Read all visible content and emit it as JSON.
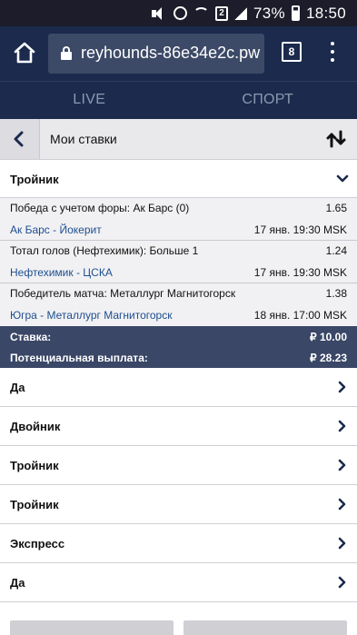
{
  "status_bar": {
    "battery": "73%",
    "time": "18:50",
    "sim_label": "2"
  },
  "browser": {
    "url": "reyhounds-86e34e2c.pw",
    "tab_count": "8"
  },
  "nav_tabs": [
    {
      "label": "LIVE"
    },
    {
      "label": "СПОРТ"
    }
  ],
  "page": {
    "title": "Мои ставки"
  },
  "expanded_bet": {
    "label": "Тройник",
    "selections": [
      {
        "market": "Победа с учетом форы: Ак Барс (0)",
        "odds": "1.65",
        "event": "Ак Барс - Йокерит",
        "time": "17 янв. 19:30 MSK"
      },
      {
        "market": "Тотал голов (Нефтехимик): Больше 1",
        "odds": "1.24",
        "event": "Нефтехимик - ЦСКА",
        "time": "17 янв. 19:30 MSK"
      },
      {
        "market": "Победитель матча: Металлург Магнитогорск",
        "odds": "1.38",
        "event": "Югра - Металлург Магнитогорск",
        "time": "18 янв. 17:00 MSK"
      }
    ],
    "stake_label": "Ставка:",
    "stake_value": "₽ 10.00",
    "payout_label": "Потенциальная выплата:",
    "payout_value": "₽ 28.23"
  },
  "bet_list": [
    {
      "label": "Да"
    },
    {
      "label": "Двойник"
    },
    {
      "label": "Тройник"
    },
    {
      "label": "Тройник"
    },
    {
      "label": "Экспресс"
    },
    {
      "label": "Да"
    }
  ],
  "colors": {
    "header_navy": "#1b2a4d",
    "summary_bg": "#3a4766",
    "link_blue": "#1e4e8f"
  }
}
